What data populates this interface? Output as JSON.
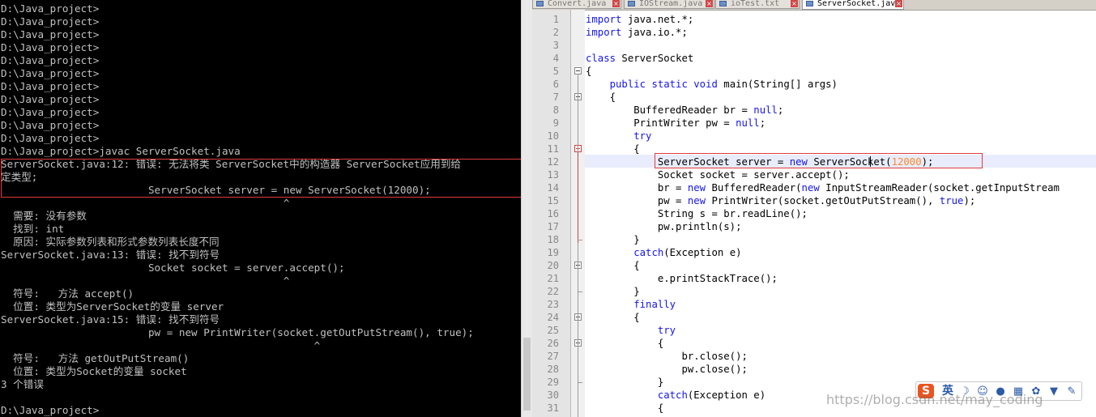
{
  "console": {
    "lines": [
      "D:\\Java_project>",
      "D:\\Java_project>",
      "D:\\Java_project>",
      "D:\\Java_project>",
      "D:\\Java_project>",
      "D:\\Java_project>",
      "D:\\Java_project>",
      "D:\\Java_project>",
      "D:\\Java_project>",
      "D:\\Java_project>",
      "D:\\Java_project>",
      "D:\\Java_project>javac ServerSocket.java",
      "ServerSocket.java:12: 错误: 无法将类 ServerSocket中的构造器 ServerSocket应用到给",
      "定类型;",
      "                        ServerSocket server = new ServerSocket(12000);",
      "                                              ^",
      "  需要: 没有参数",
      "  找到: int",
      "  原因: 实际参数列表和形式参数列表长度不同",
      "ServerSocket.java:13: 错误: 找不到符号",
      "                        Socket socket = server.accept();",
      "                                              ^",
      "  符号:   方法 accept()",
      "  位置: 类型为ServerSocket的变量 server",
      "ServerSocket.java:15: 错误: 找不到符号",
      "                        pw = new PrintWriter(socket.getOutPutStream(), true);",
      "                                                   ^",
      "  符号:   方法 getOutPutStream()",
      "  位置: 类型为Socket的变量 socket",
      "3 个错误",
      "",
      "D:\\Java_project>"
    ]
  },
  "editor": {
    "tabs": [
      {
        "label": "Convert.java",
        "active": false
      },
      {
        "label": "IOStream.java",
        "active": false
      },
      {
        "label": "ioTest.txt",
        "active": false
      },
      {
        "label": "ServerSocket.java",
        "active": true
      }
    ],
    "line_numbers": [
      "1",
      "2",
      "3",
      "4",
      "5",
      "6",
      "7",
      "8",
      "9",
      "10",
      "11",
      "12",
      "13",
      "14",
      "15",
      "16",
      "17",
      "18",
      "19",
      "20",
      "21",
      "22",
      "23",
      "24",
      "25",
      "26",
      "27",
      "28",
      "29",
      "30",
      "31"
    ],
    "code": [
      [
        [
          "k",
          "import"
        ],
        [
          "p",
          " java.net.*;"
        ]
      ],
      [
        [
          "k",
          "import"
        ],
        [
          "p",
          " java.io.*;"
        ]
      ],
      [],
      [
        [
          "k",
          "class"
        ],
        [
          "p",
          " ServerSocket"
        ]
      ],
      [
        [
          "p",
          "{"
        ]
      ],
      [
        [
          "p",
          "    "
        ],
        [
          "k",
          "public static void"
        ],
        [
          "p",
          " main(String[] args)"
        ]
      ],
      [
        [
          "p",
          "    {"
        ]
      ],
      [
        [
          "p",
          "        BufferedReader br = "
        ],
        [
          "k",
          "null"
        ],
        [
          "p",
          ";"
        ]
      ],
      [
        [
          "p",
          "        PrintWriter pw = "
        ],
        [
          "k",
          "null"
        ],
        [
          "p",
          ";"
        ]
      ],
      [
        [
          "p",
          "        "
        ],
        [
          "k",
          "try"
        ]
      ],
      [
        [
          "p",
          "        {"
        ]
      ],
      [
        [
          "p",
          "            ServerSocket server = "
        ],
        [
          "k",
          "new"
        ],
        [
          "p",
          " ServerSocket("
        ],
        [
          "n",
          "12000"
        ],
        [
          "p",
          ");"
        ]
      ],
      [
        [
          "p",
          "            Socket socket = server.accept();"
        ]
      ],
      [
        [
          "p",
          "            br = "
        ],
        [
          "k",
          "new"
        ],
        [
          "p",
          " BufferedReader("
        ],
        [
          "k",
          "new"
        ],
        [
          "p",
          " InputStreamReader(socket.getInputStream"
        ]
      ],
      [
        [
          "p",
          "            pw = "
        ],
        [
          "k",
          "new"
        ],
        [
          "p",
          " PrintWriter(socket.getOutPutStream(), "
        ],
        [
          "k",
          "true"
        ],
        [
          "p",
          ");"
        ]
      ],
      [
        [
          "p",
          "            String s = br.readLine();"
        ]
      ],
      [
        [
          "p",
          "            pw.println(s);"
        ]
      ],
      [
        [
          "p",
          "        }"
        ]
      ],
      [
        [
          "p",
          "        "
        ],
        [
          "k",
          "catch"
        ],
        [
          "p",
          "(Exception e)"
        ]
      ],
      [
        [
          "p",
          "        {"
        ]
      ],
      [
        [
          "p",
          "            e.printStackTrace();"
        ]
      ],
      [
        [
          "p",
          "        }"
        ]
      ],
      [
        [
          "p",
          "        "
        ],
        [
          "k",
          "finally"
        ]
      ],
      [
        [
          "p",
          "        {"
        ]
      ],
      [
        [
          "p",
          "            "
        ],
        [
          "k",
          "try"
        ]
      ],
      [
        [
          "p",
          "            {"
        ]
      ],
      [
        [
          "p",
          "                br.close();"
        ]
      ],
      [
        [
          "p",
          "                pw.close();"
        ]
      ],
      [
        [
          "p",
          "            }"
        ]
      ],
      [
        [
          "p",
          "            "
        ],
        [
          "k",
          "catch"
        ],
        [
          "p",
          "(Exception e)"
        ]
      ],
      [
        [
          "p",
          "            {"
        ]
      ]
    ]
  },
  "ime": {
    "logo": "S",
    "mode": "英",
    "icons": [
      "moon-icon",
      "smiley-icon",
      "microphone-icon",
      "keyboard-icon",
      "skin-icon",
      "shirt-icon",
      "wrench-icon"
    ]
  },
  "watermark": "https://blog.csdn.net/may_coding",
  "colors": {
    "keyword": "#1515ee",
    "number": "#ff8a2a",
    "error_box": "#e03c3c"
  }
}
